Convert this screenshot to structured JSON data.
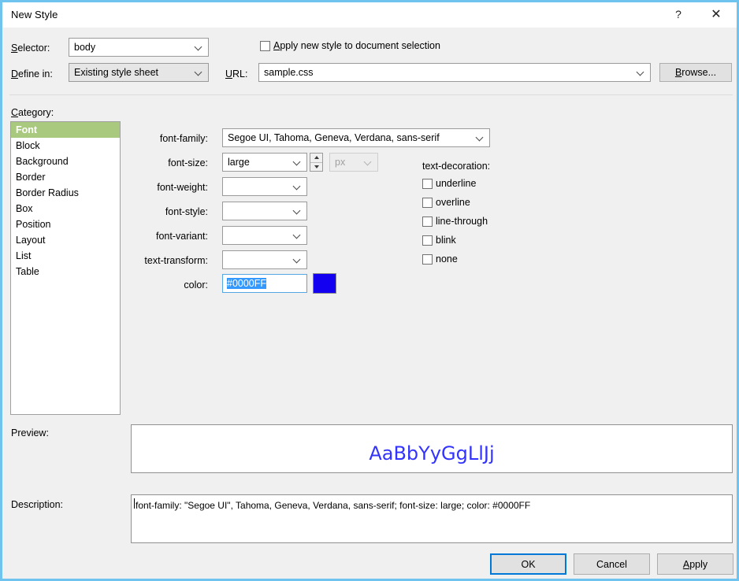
{
  "window": {
    "title": "New Style",
    "help_icon": "question-mark-icon",
    "close_icon": "close-icon"
  },
  "top": {
    "selector_label": "Selector:",
    "selector_label_accel": "S",
    "selector_value": "body",
    "apply_checkbox_label": "Apply new style to document selection",
    "apply_checkbox_checked": false,
    "define_in_label": "Define in:",
    "define_in_value": "Existing style sheet",
    "url_label": "URL:",
    "url_value": "sample.css",
    "browse_label": "Browse..."
  },
  "category": {
    "label": "Category:",
    "items": [
      {
        "label": "Font",
        "selected": true
      },
      {
        "label": "Block",
        "selected": false
      },
      {
        "label": "Background",
        "selected": false
      },
      {
        "label": "Border",
        "selected": false
      },
      {
        "label": "Border Radius",
        "selected": false
      },
      {
        "label": "Box",
        "selected": false
      },
      {
        "label": "Position",
        "selected": false
      },
      {
        "label": "Layout",
        "selected": false
      },
      {
        "label": "List",
        "selected": false
      },
      {
        "label": "Table",
        "selected": false
      }
    ]
  },
  "font_panel": {
    "font_family_label": "font-family:",
    "font_family_value": "Segoe UI, Tahoma, Geneva, Verdana, sans-serif",
    "font_size_label": "font-size:",
    "font_size_value": "large",
    "font_size_unit": "px",
    "font_size_unit_disabled": true,
    "font_weight_label": "font-weight:",
    "font_weight_value": "",
    "font_style_label": "font-style:",
    "font_style_value": "",
    "font_variant_label": "font-variant:",
    "font_variant_value": "",
    "text_transform_label": "text-transform:",
    "text_transform_value": "",
    "color_label": "color:",
    "color_value": "#0000FF",
    "color_swatch_hex": "#1400f0"
  },
  "text_decoration": {
    "label": "text-decoration:",
    "options": [
      {
        "label": "underline",
        "checked": false
      },
      {
        "label": "overline",
        "checked": false
      },
      {
        "label": "line-through",
        "checked": false
      },
      {
        "label": "blink",
        "checked": false
      },
      {
        "label": "none",
        "checked": false
      }
    ]
  },
  "preview": {
    "label": "Preview:",
    "sample_text": "AaBbYyGgLlJj",
    "sample_color": "#3333ff"
  },
  "description": {
    "label": "Description:",
    "text": "font-family: \"Segoe UI\", Tahoma, Geneva, Verdana, sans-serif; font-size: large; color: #0000FF"
  },
  "footer": {
    "ok_label": "OK",
    "cancel_label": "Cancel",
    "apply_label": "Apply",
    "apply_accel": "A"
  }
}
